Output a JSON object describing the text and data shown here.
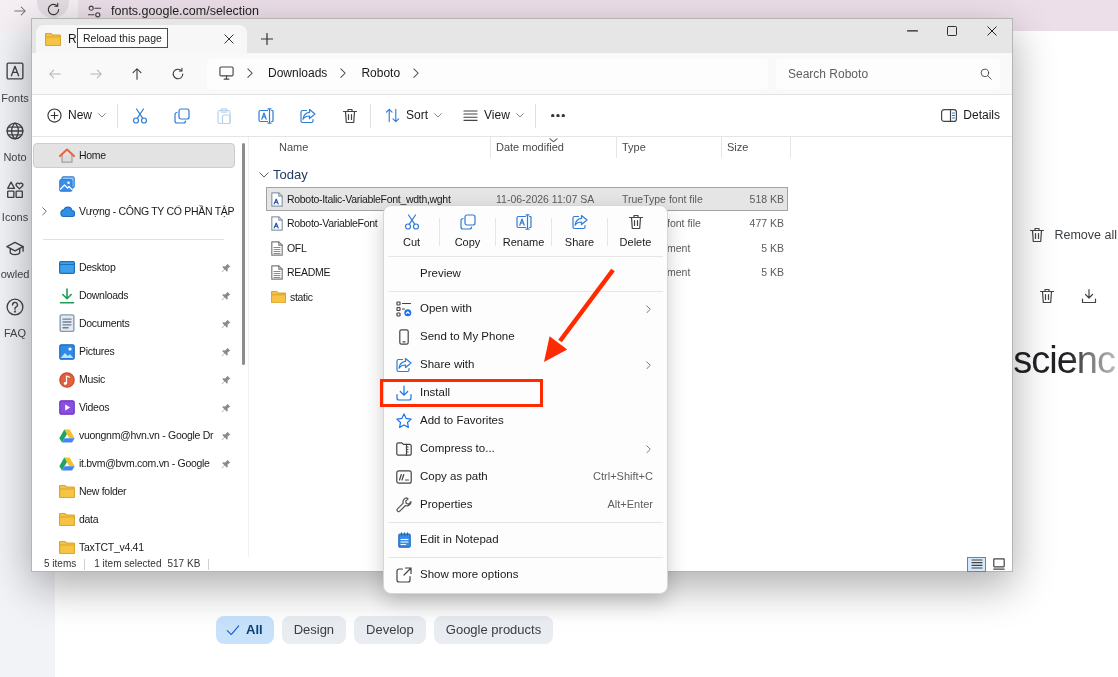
{
  "browser": {
    "url": "fonts.google.com/selection",
    "tooltip": "Reload this page"
  },
  "site_nav": [
    {
      "label": "Fonts"
    },
    {
      "label": "Noto"
    },
    {
      "label": "Icons"
    },
    {
      "label": "owled"
    },
    {
      "label": "FAQ"
    }
  ],
  "page": {
    "remove_all": "Remove all",
    "heading_fragment": "scienc",
    "filters": [
      {
        "label": "All",
        "selected": true
      },
      {
        "label": "Design",
        "selected": false
      },
      {
        "label": "Develop",
        "selected": false
      },
      {
        "label": "Google products",
        "selected": false
      }
    ]
  },
  "explorer": {
    "tab_title": "R",
    "nav_buttons": [
      {
        "disabled": true
      },
      {
        "disabled": true
      },
      {
        "disabled": false
      },
      {
        "disabled": false
      }
    ],
    "breadcrumb": [
      "Downloads",
      "Roboto"
    ],
    "search": {
      "placeholder": "Search Roboto"
    },
    "command_groups": [
      [
        {
          "kind": "dropdown",
          "label": "New"
        }
      ],
      [
        {
          "kind": "icon",
          "disabled": false
        },
        {
          "kind": "icon",
          "disabled": false
        },
        {
          "kind": "icon",
          "disabled": true
        },
        {
          "kind": "icon",
          "disabled": false
        },
        {
          "kind": "icon",
          "disabled": false
        },
        {
          "kind": "icon",
          "disabled": false
        }
      ],
      [
        {
          "kind": "dropdown",
          "label": "Sort"
        },
        {
          "kind": "dropdown",
          "label": "View"
        }
      ],
      [
        {
          "kind": "icon",
          "disabled": false
        }
      ]
    ],
    "details_button": "Details",
    "nav_pane": [
      [
        {
          "label": "Home",
          "selected": true
        },
        {
          "selected": false
        },
        {
          "label": "Vượng - CÔNG TY CỔ PHẦN TẬP",
          "selected": false,
          "expanded": false
        }
      ],
      [
        {
          "label": "Desktop",
          "selected": false,
          "pinned": true
        },
        {
          "label": "Downloads",
          "selected": false,
          "pinned": true
        },
        {
          "label": "Documents",
          "selected": false,
          "pinned": true
        },
        {
          "label": "Pictures",
          "selected": false,
          "pinned": true
        },
        {
          "label": "Music",
          "selected": false,
          "pinned": true
        },
        {
          "label": "Videos",
          "selected": false,
          "pinned": true
        },
        {
          "label": "vuongnm@hvn.vn - Google Dr",
          "selected": false,
          "pinned": true
        },
        {
          "label": "it.bvm@bvm.com.vn - Google",
          "selected": false,
          "pinned": true
        },
        {
          "label": "New folder",
          "selected": false,
          "pinned": false
        },
        {
          "label": "data",
          "selected": false,
          "pinned": false
        },
        {
          "label": "TaxTCT_v4.41",
          "selected": false,
          "pinned": false
        }
      ]
    ],
    "columns": [
      {
        "label": "Name",
        "sorted": false
      },
      {
        "label": "Date modified",
        "sorted": true
      },
      {
        "label": "Type",
        "sorted": false
      },
      {
        "label": "Size",
        "sorted": false
      }
    ],
    "group": {
      "label": "Today",
      "expanded": true
    },
    "files": [
      {
        "kind": "font",
        "name": "Roboto-Italic-VariableFont_wdth,wght",
        "date": "11-06-2026 11:07 SA",
        "type": "TrueType font file",
        "size": "518 KB",
        "selected": true,
        "covered": false
      },
      {
        "kind": "font",
        "name": "Roboto-VariableFont",
        "type": "font file",
        "size": "477 KB",
        "selected": false,
        "covered": true
      },
      {
        "kind": "document",
        "name": "OFL",
        "type": "ment",
        "size": "5 KB",
        "selected": false,
        "covered": true
      },
      {
        "kind": "document",
        "name": "README",
        "type": "ment",
        "size": "5 KB",
        "selected": false,
        "covered": true
      },
      {
        "kind": "folder",
        "name": "static",
        "selected": false
      }
    ],
    "status_bar": {
      "item_count": "5 items",
      "selection": "1 item selected",
      "selection_size": "517 KB",
      "views": [
        {
          "selected": true
        },
        {
          "selected": false
        }
      ]
    }
  },
  "context_menu": {
    "quick_actions": [
      {
        "label": "Cut"
      },
      {
        "label": "Copy"
      },
      {
        "label": "Rename"
      },
      {
        "label": "Share"
      },
      {
        "label": "Delete"
      }
    ],
    "groups": [
      [
        {
          "label": "Preview",
          "submenu": false,
          "highlighted": false
        }
      ],
      [
        {
          "label": "Open with",
          "submenu": true,
          "highlighted": false
        },
        {
          "label": "Send to My Phone",
          "submenu": false,
          "highlighted": false
        },
        {
          "label": "Share with",
          "submenu": true,
          "highlighted": false
        },
        {
          "label": "Install",
          "submenu": false,
          "highlighted": true
        },
        {
          "label": "Add to Favorites",
          "submenu": false,
          "highlighted": false
        },
        {
          "label": "Compress to...",
          "submenu": true,
          "highlighted": false
        },
        {
          "label": "Copy as path",
          "shortcut": "Ctrl+Shift+C",
          "submenu": false,
          "highlighted": false
        },
        {
          "label": "Properties",
          "shortcut": "Alt+Enter",
          "submenu": false,
          "highlighted": false
        }
      ],
      [
        {
          "label": "Edit in Notepad",
          "submenu": false,
          "highlighted": false
        }
      ],
      [
        {
          "label": "Show more options",
          "submenu": false,
          "highlighted": false
        }
      ]
    ]
  }
}
